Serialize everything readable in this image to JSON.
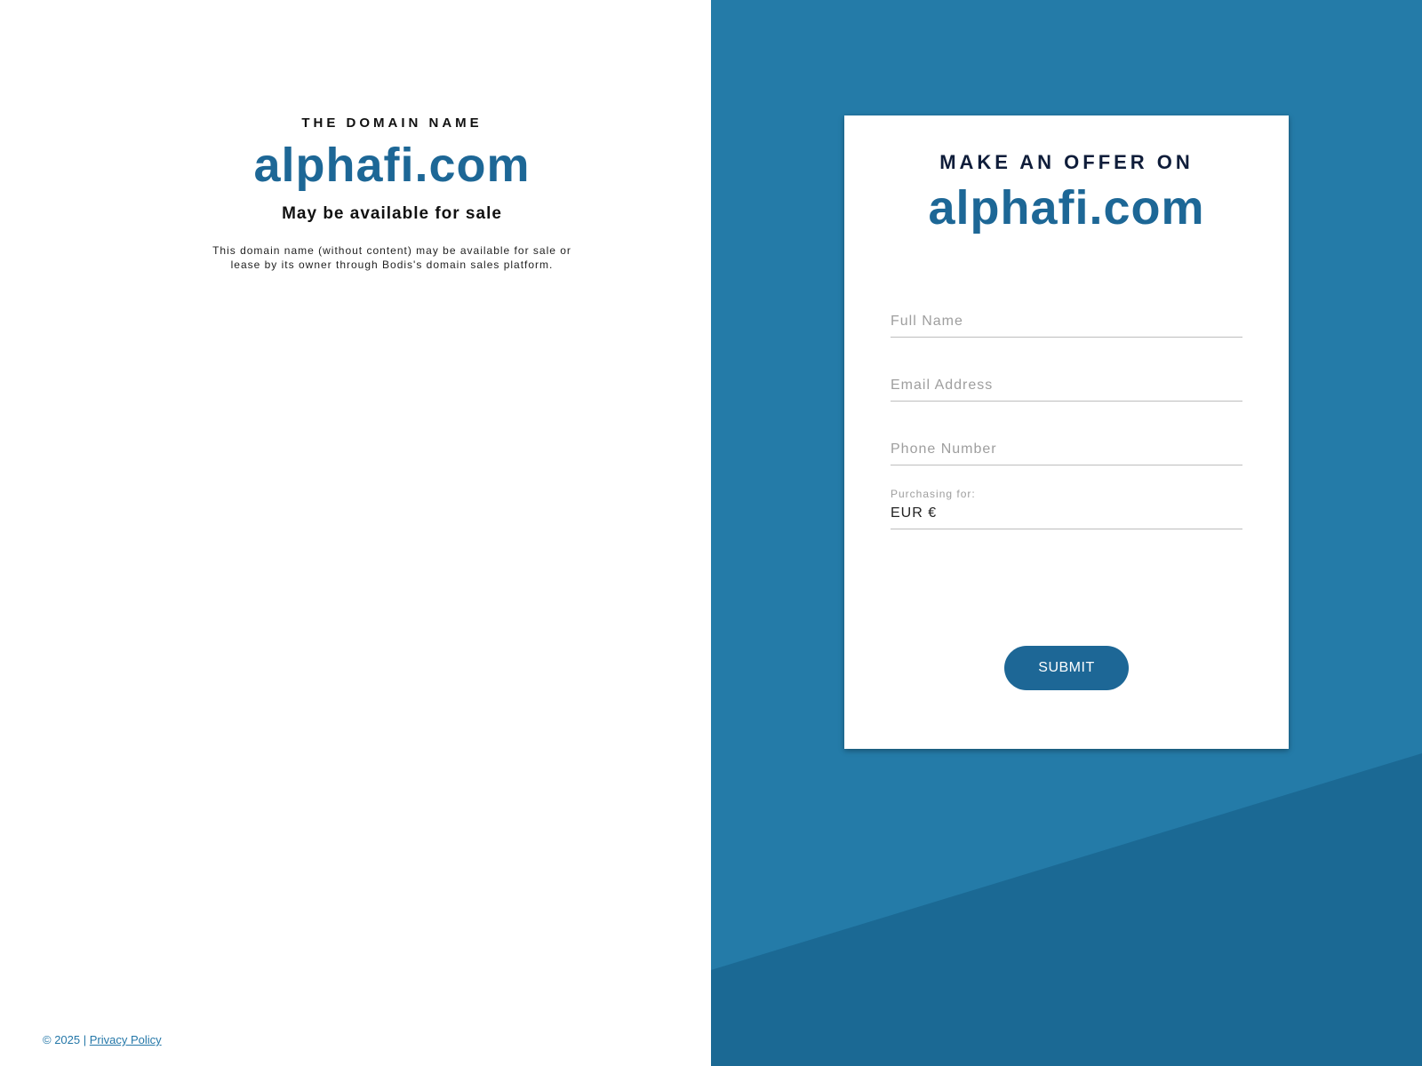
{
  "left": {
    "eyebrow": "THE DOMAIN NAME",
    "domain": "alphafi.com",
    "subhead": "May be available for sale",
    "description": "This domain name (without content) may be available for sale or lease by its owner through Bodis's domain sales platform."
  },
  "footer": {
    "copyright": "© 2025 |",
    "privacy_link": "Privacy Policy"
  },
  "card": {
    "eyebrow": "MAKE AN OFFER ON",
    "domain": "alphafi.com",
    "fields": {
      "full_name_placeholder": "Full Name",
      "email_placeholder": "Email Address",
      "phone_placeholder": "Phone Number",
      "purchasing_label": "Purchasing for:",
      "purchasing_value": "EUR €"
    },
    "submit_label": "SUBMIT"
  },
  "colors": {
    "accent": "#1d6796",
    "panel_bg": "#247ba8",
    "panel_bg_dark": "#1b6994"
  }
}
